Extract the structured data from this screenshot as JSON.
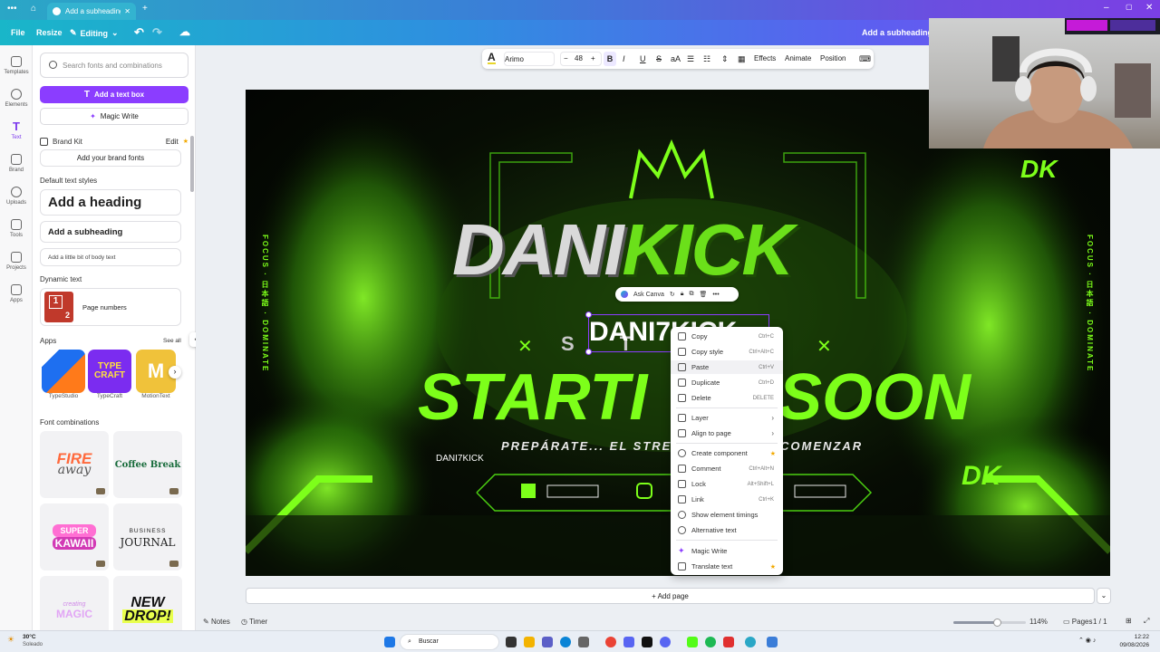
{
  "browser": {
    "tab_title": "Add a subheading - ...",
    "new_tab": "+"
  },
  "toolbar": {
    "file": "File",
    "resize": "Resize",
    "editing": "Editing",
    "doc_title": "Add a subheading"
  },
  "rail": [
    {
      "label": "Templates"
    },
    {
      "label": "Elements"
    },
    {
      "label": "Text"
    },
    {
      "label": "Brand"
    },
    {
      "label": "Uploads"
    },
    {
      "label": "Tools"
    },
    {
      "label": "Projects"
    },
    {
      "label": "Apps"
    }
  ],
  "panel": {
    "search_placeholder": "Search fonts and combinations",
    "add_text_box": "Add a text box",
    "magic_write": "Magic Write",
    "brand_kit": "Brand Kit",
    "brand_edit": "Edit",
    "add_brand_fonts": "Add your brand fonts",
    "default_styles": "Default text styles",
    "heading": "Add a heading",
    "subheading": "Add a subheading",
    "body": "Add a little bit of body text",
    "dynamic_text": "Dynamic text",
    "page_numbers": "Page numbers",
    "page_number_glyph_1": "1",
    "page_number_glyph_2": "2",
    "apps": "Apps",
    "see_all": "See all",
    "app_items": [
      {
        "label": "TypeStudio"
      },
      {
        "label": "TypeCraft"
      },
      {
        "label": "MotionText"
      }
    ],
    "font_combinations": "Font combinations",
    "combos": [
      {
        "line1": "FIRE",
        "line2": "away"
      },
      {
        "line1": "Coffee Break",
        "line2": ""
      },
      {
        "line1": "SUPER",
        "line2": "KAWAII"
      },
      {
        "line1": "BUSINESS",
        "line2": "JOURNAL"
      },
      {
        "line1": "creating",
        "line2": "MAGIC"
      },
      {
        "line1": "NEW",
        "line2": "DROP!"
      }
    ]
  },
  "text_toolbar": {
    "font": "Arimo",
    "minus": "−",
    "size": "48",
    "plus": "+",
    "bold": "B",
    "italic": "I",
    "underline": "U",
    "strike": "S",
    "case": "aA",
    "effects": "Effects",
    "animate": "Animate",
    "position": "Position"
  },
  "canvas": {
    "side_text_left": "FOCUS · 日本語 · DOMINATE",
    "side_text_right": "FOCUS · 日本語 · DOMINATE",
    "logo_white": "DANI",
    "logo_green": "KICK",
    "selected_text": "DANI7KICK",
    "streaming_text": "S T R",
    "starting": "STARTI",
    "soon": "SOON",
    "tagline": "PREPÁRATE... EL STRE",
    "tagline_end": "COMENZAR",
    "loose_text": "DANI7KICK",
    "dk_mark": "DK",
    "ask_canva": "Ask Canva"
  },
  "context_menu": [
    {
      "label": "Copy",
      "shortcut": "Ctrl+C"
    },
    {
      "label": "Copy style",
      "shortcut": "Ctrl+Alt+C"
    },
    {
      "label": "Paste",
      "shortcut": "Ctrl+V"
    },
    {
      "label": "Duplicate",
      "shortcut": "Ctrl+D"
    },
    {
      "label": "Delete",
      "shortcut": "DELETE"
    },
    {
      "label": "Layer",
      "shortcut": "›"
    },
    {
      "label": "Align to page",
      "shortcut": "›"
    },
    {
      "label": "Create component",
      "shortcut": "★"
    },
    {
      "label": "Comment",
      "shortcut": "Ctrl+Alt+N"
    },
    {
      "label": "Lock",
      "shortcut": "Alt+Shift+L"
    },
    {
      "label": "Link",
      "shortcut": "Ctrl+K"
    },
    {
      "label": "Show element timings",
      "shortcut": ""
    },
    {
      "label": "Alternative text",
      "shortcut": ""
    },
    {
      "label": "Magic Write",
      "shortcut": ""
    },
    {
      "label": "Translate text",
      "shortcut": "★"
    }
  ],
  "bottom": {
    "add_page": "+ Add page",
    "notes": "Notes",
    "timer": "Timer",
    "zoom": "114%",
    "zoom_level": 0.6,
    "pages": "Pages",
    "page_count": "1 / 1"
  },
  "taskbar": {
    "weather_temp": "30°C",
    "weather_desc": "Soleado",
    "search": "Buscar",
    "time": "12:22",
    "date": "09/08/2026"
  },
  "colors": {
    "accent": "#8b3dff",
    "neon_green": "#7dff1a"
  }
}
